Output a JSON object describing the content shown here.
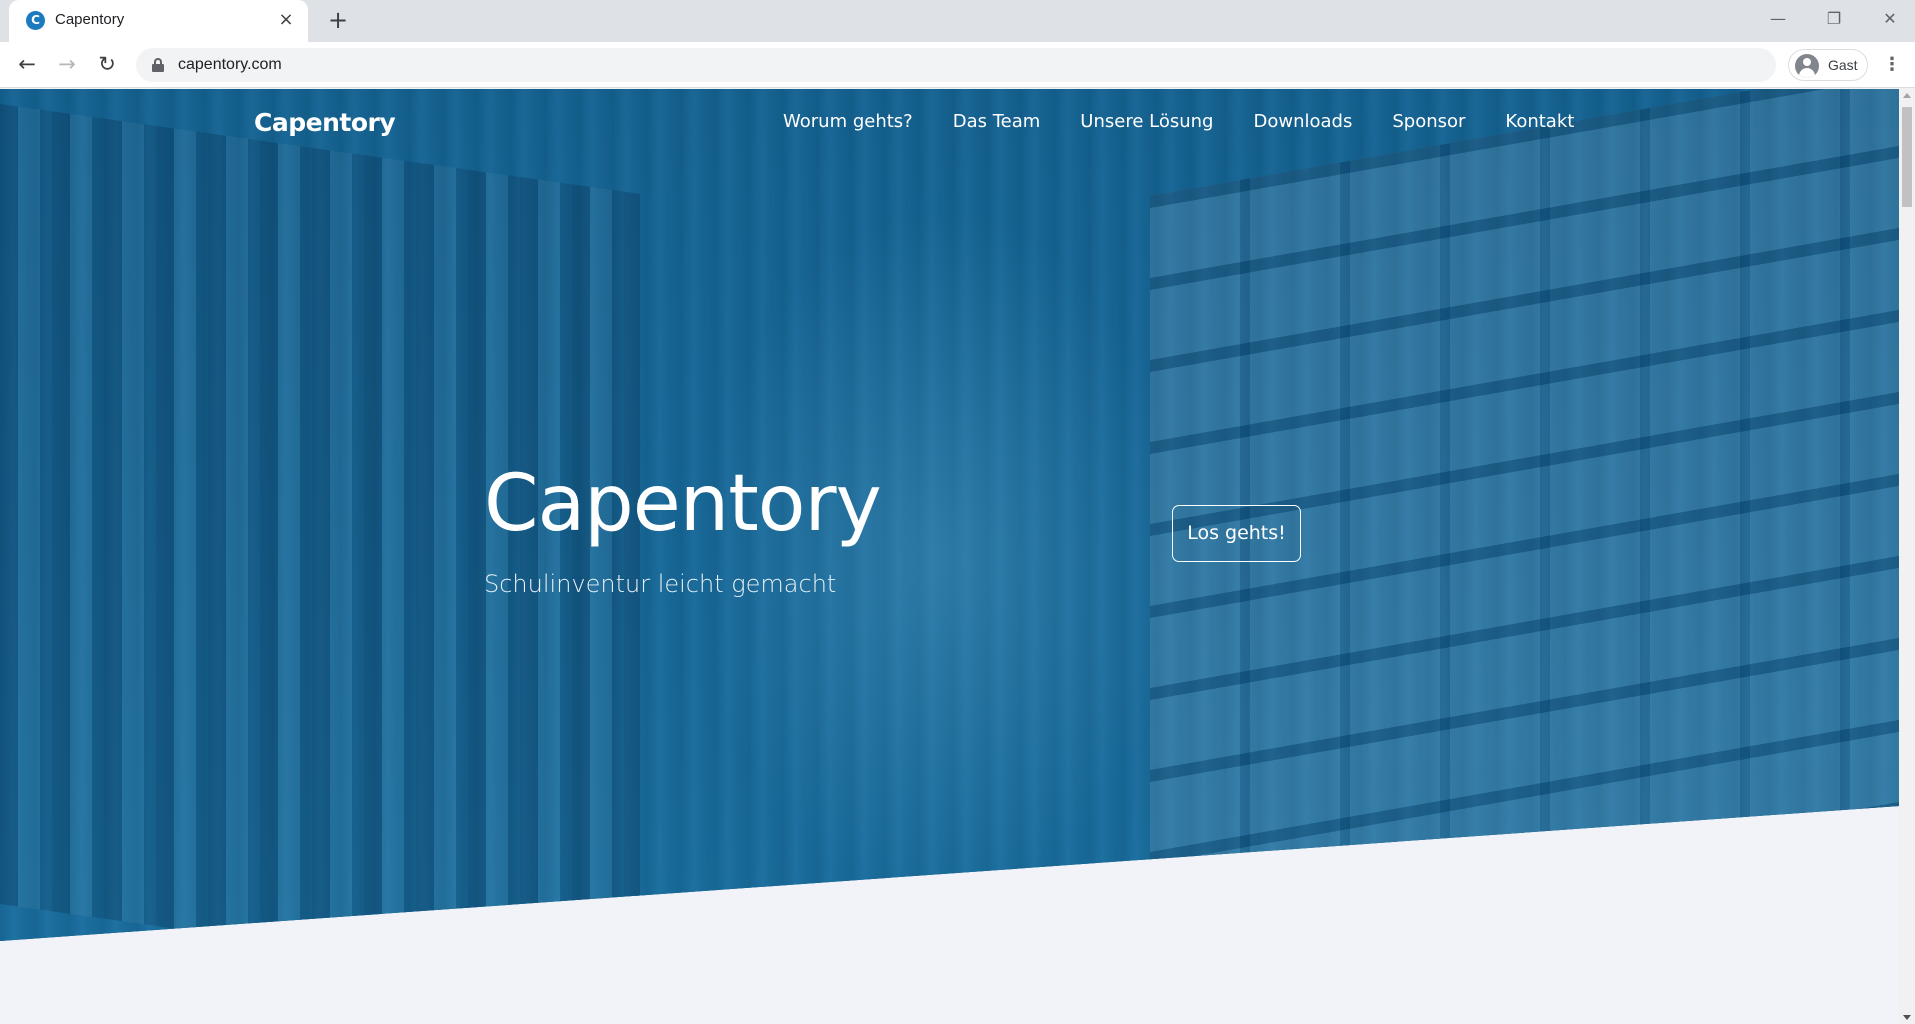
{
  "browser": {
    "tab": {
      "title": "Capentory",
      "favicon_letter": "C"
    },
    "new_tab_label": "+",
    "window_controls": {
      "minimize": "—",
      "maximize": "❐",
      "close": "✕"
    },
    "address_bar": {
      "url": "capentory.com"
    },
    "profile": {
      "label": "Gast"
    },
    "menu_label": "⋮"
  },
  "site": {
    "brand": "Capentory",
    "nav": [
      {
        "label": "Worum gehts?"
      },
      {
        "label": "Das Team"
      },
      {
        "label": "Unsere Lösung"
      },
      {
        "label": "Downloads"
      },
      {
        "label": "Sponsor"
      },
      {
        "label": "Kontakt"
      }
    ],
    "hero": {
      "title": "Capentory",
      "subtitle": "Schulinventur leicht gemacht",
      "cta_label": "Los gehts!"
    }
  },
  "colors": {
    "hero_overlay": "#1a6e9e",
    "page_background": "#f2f3f8",
    "text_on_hero": "#ffffff"
  }
}
